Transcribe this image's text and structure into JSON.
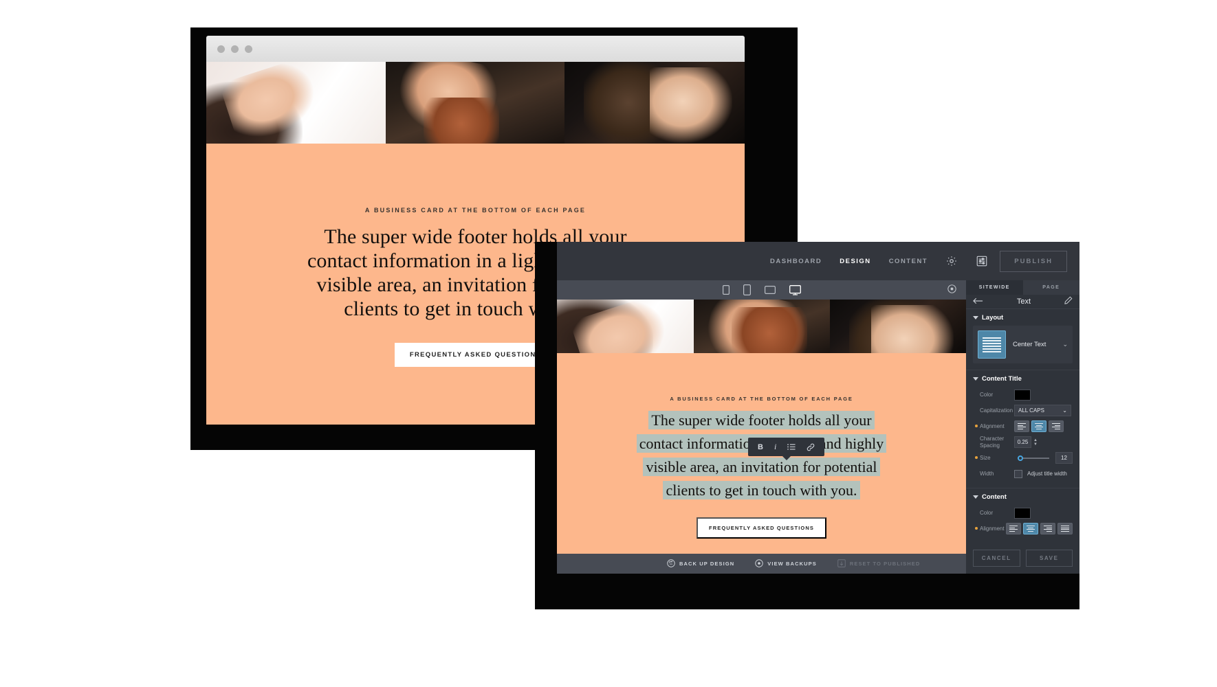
{
  "browser": {
    "traffic_lights": [
      "close-dot",
      "minimize-dot",
      "zoom-dot"
    ],
    "site": {
      "eyebrow": "A BUSINESS CARD AT THE BOTTOM OF EACH PAGE",
      "headline_lines": [
        "The super wide footer holds all your",
        "contact information in a light and highly",
        "visible area, an invitation for potential",
        "clients to get in touch with you."
      ],
      "cta_label": "FREQUENTLY ASKED QUESTIONS",
      "background_color": "#fdb78c"
    }
  },
  "editor": {
    "topbar": {
      "nav": [
        {
          "label": "DASHBOARD",
          "active": false
        },
        {
          "label": "DESIGN",
          "active": true
        },
        {
          "label": "CONTENT",
          "active": false
        }
      ],
      "icons": [
        "gear-icon",
        "sliders-icon"
      ],
      "publish_label": "PUBLISH"
    },
    "devicebar": {
      "devices": [
        "mobile-portrait-icon",
        "mobile-landscape-icon",
        "tablet-icon",
        "desktop-icon"
      ],
      "active_device": "desktop-icon",
      "preview_icon": "eye-icon"
    },
    "preview": {
      "eyebrow": "A BUSINESS CARD AT THE BOTTOM OF EACH PAGE",
      "headline_lines": [
        "The super wide footer holds all your",
        "contact information in a light and highly",
        "visible area, an invitation for potential",
        "clients to get in touch with you."
      ],
      "cta_label": "FREQUENTLY ASKED QUESTIONS",
      "selection_color": "#b3c2bc",
      "background_color": "#fdb78c"
    },
    "text_toolbar": {
      "buttons": [
        "bold-icon",
        "italic-icon",
        "bullet-list-icon",
        "link-icon"
      ],
      "bold_label": "B",
      "italic_label": "i"
    },
    "bottombar": {
      "items": [
        {
          "label": "BACK UP DESIGN",
          "icon": "backup-icon",
          "disabled": false
        },
        {
          "label": "VIEW BACKUPS",
          "icon": "eye-circle-icon",
          "disabled": false
        },
        {
          "label": "RESET TO PUBLISHED",
          "icon": "reset-icon",
          "disabled": true
        }
      ]
    },
    "sidebar": {
      "tabs": [
        {
          "label": "SITEWIDE",
          "active": true
        },
        {
          "label": "PAGE",
          "active": false
        }
      ],
      "header": {
        "back_icon": "arrow-left-icon",
        "title": "Text",
        "edit_icon": "pencil-icon"
      },
      "layout": {
        "section_title": "Layout",
        "thumb_icon": "center-text-thumb",
        "value": "Center Text"
      },
      "content_title": {
        "section_title": "Content Title",
        "color_label": "Color",
        "color_value": "#000000",
        "capitalization_label": "Capitalization",
        "capitalization_value": "ALL CAPS",
        "alignment_label": "Alignment",
        "alignment_active": "center",
        "character_spacing_label": "Character Spacing",
        "character_spacing_value": "0.25",
        "size_label": "Size",
        "size_value": "12",
        "width_label": "Width",
        "width_checkbox_label": "Adjust title width",
        "width_checked": false
      },
      "content": {
        "section_title": "Content",
        "color_label": "Color",
        "color_value": "#000000",
        "alignment_label": "Alignment",
        "alignment_active": "center"
      },
      "actions": {
        "cancel_label": "CANCEL",
        "save_label": "SAVE"
      }
    }
  }
}
